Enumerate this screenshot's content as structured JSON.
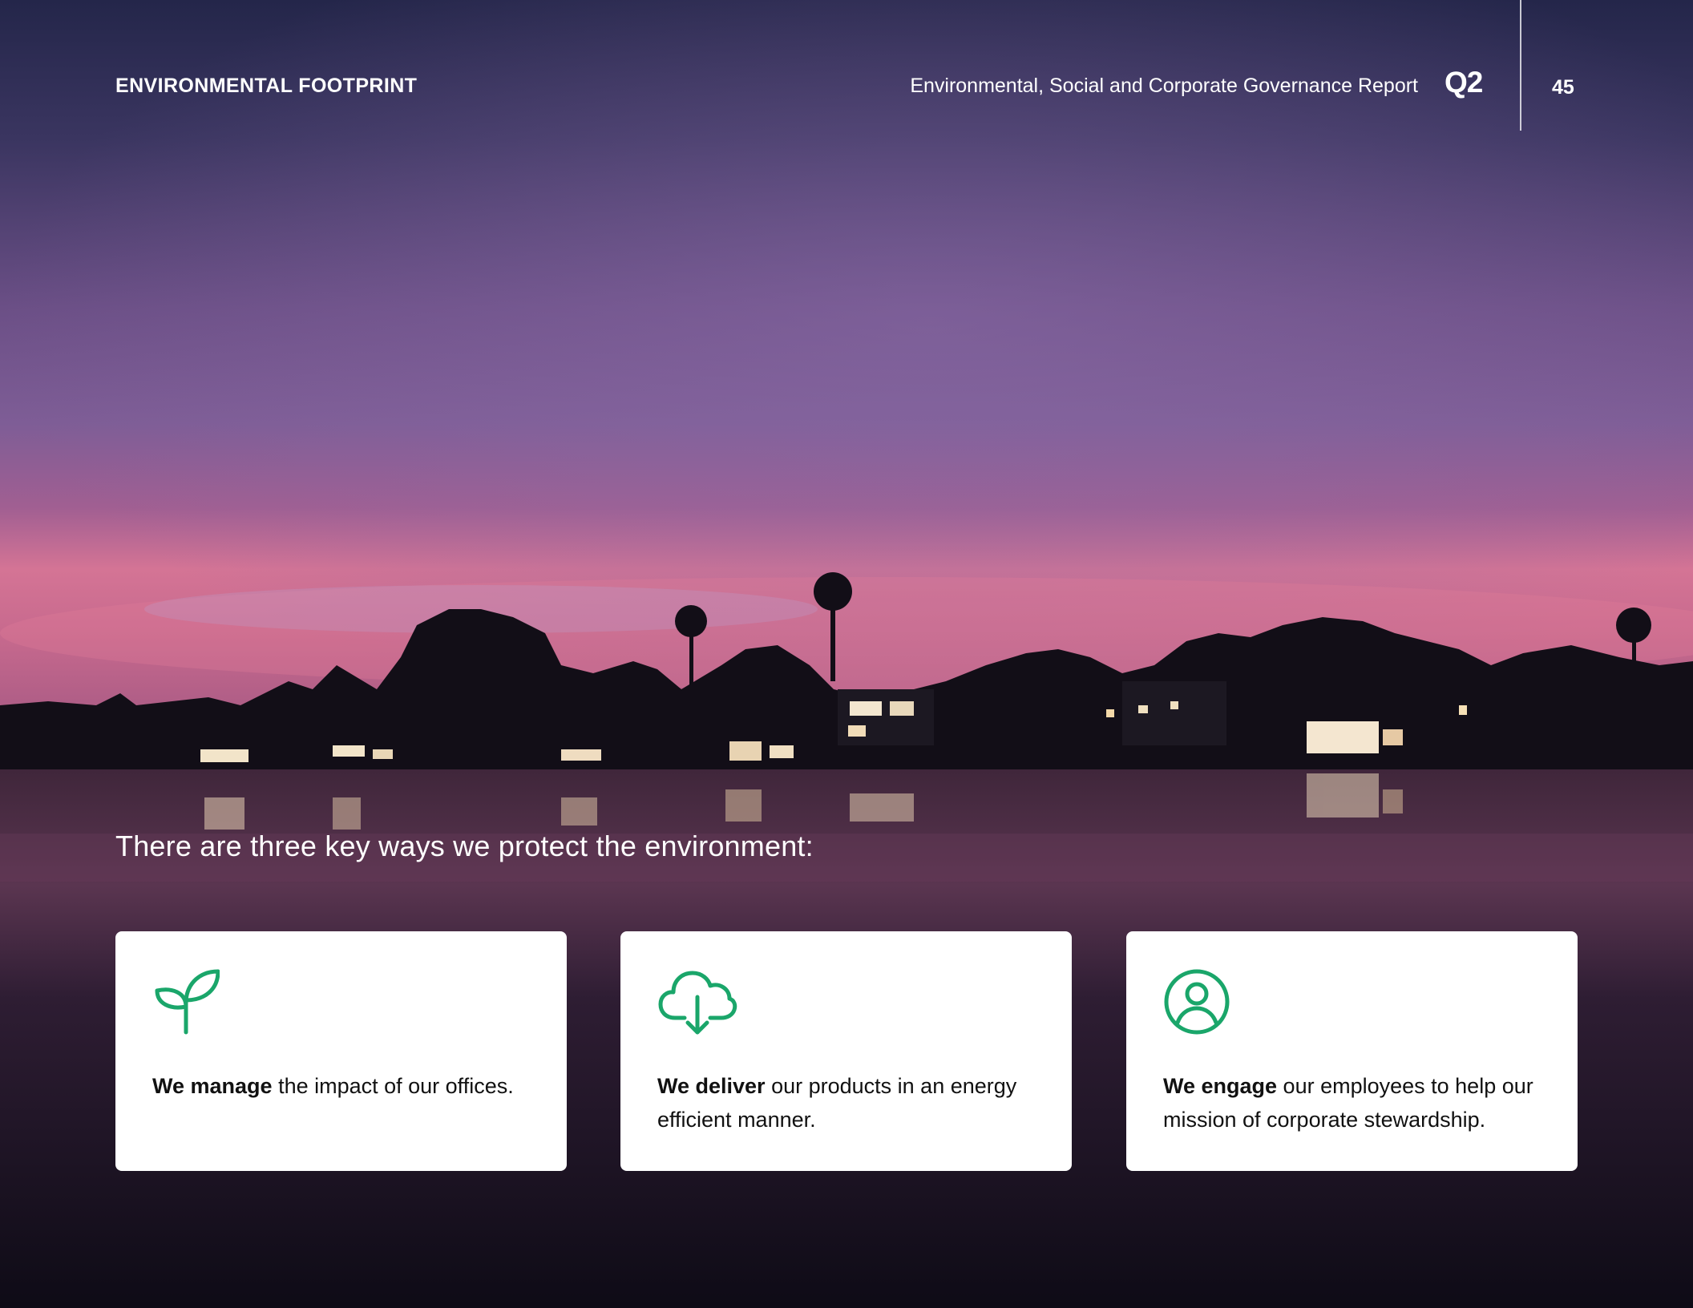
{
  "header": {
    "section": "ENVIRONMENTAL FOOTPRINT",
    "report_title": "Environmental, Social and Corporate Governance Report",
    "logo_text": "Q2",
    "page_number": "45"
  },
  "intro": "There are three key ways we protect the environment:",
  "cards": [
    {
      "icon": "sprout-icon",
      "bold": "We manage",
      "text": " the impact of our offices."
    },
    {
      "icon": "cloud-download-icon",
      "bold": "We deliver",
      "text": " our products in an energy efficient manner."
    },
    {
      "icon": "user-circle-icon",
      "bold": "We engage",
      "text": " our employees to help our mission of corporate stewardship."
    }
  ],
  "colors": {
    "accent_green": "#1aa66a",
    "sky_top": "#2a2a4e",
    "sky_mid": "#7a5a92",
    "sunset_pink": "#d9708f",
    "water_dark": "#120d1b"
  }
}
